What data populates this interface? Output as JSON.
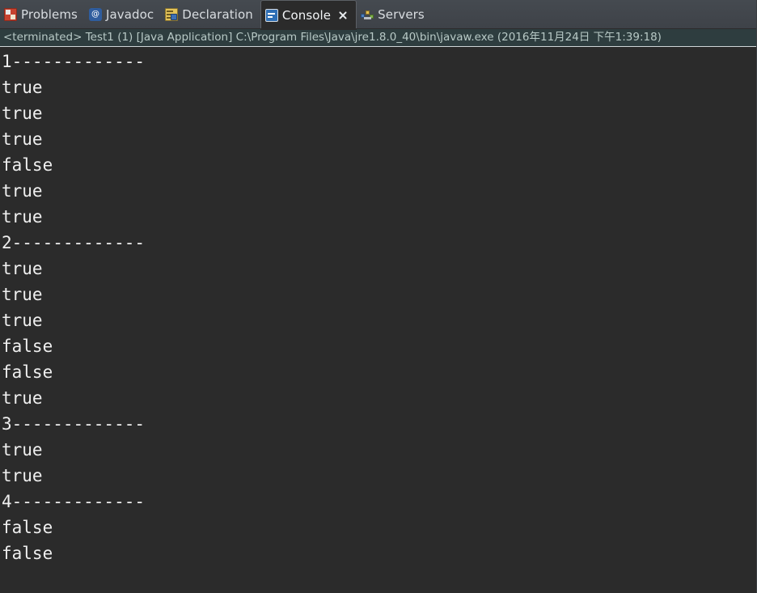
{
  "window": {
    "title": "Console",
    "background_color": "#2b2b2b",
    "tabbar_color": "#40444a",
    "text_color": "#efefef"
  },
  "tabbar": {
    "tabs": [
      {
        "label": "Problems",
        "icon": "problems-icon",
        "selected": false,
        "closable": false
      },
      {
        "label": "Javadoc",
        "icon": "javadoc-icon",
        "selected": false,
        "closable": false,
        "glyph": "@"
      },
      {
        "label": "Declaration",
        "icon": "declaration-icon",
        "selected": false,
        "closable": false
      },
      {
        "label": "Console",
        "icon": "console-icon",
        "selected": true,
        "closable": true
      },
      {
        "label": "Servers",
        "icon": "servers-icon",
        "selected": false,
        "closable": false
      }
    ]
  },
  "status": {
    "text": "<terminated> Test1 (1) [Java Application] C:\\Program Files\\Java\\jre1.8.0_40\\bin\\javaw.exe (2016年11月24日 下午1:39:18)",
    "state": "terminated",
    "launch_name": "Test1 (1)",
    "launch_type": "Java Application",
    "vm_path": "C:\\Program Files\\Java\\jre1.8.0_40\\bin\\javaw.exe",
    "timestamp": "2016年11月24日 下午1:39:18",
    "background_color": "#2e3d3f",
    "text_color": "#b8c9c6"
  },
  "console": {
    "lines": [
      "1-------------",
      "true",
      "true",
      "true",
      "false",
      "true",
      "true",
      "2-------------",
      "true",
      "true",
      "true",
      "false",
      "false",
      "true",
      "3-------------",
      "true",
      "true",
      "4-------------",
      "false",
      "false"
    ]
  }
}
